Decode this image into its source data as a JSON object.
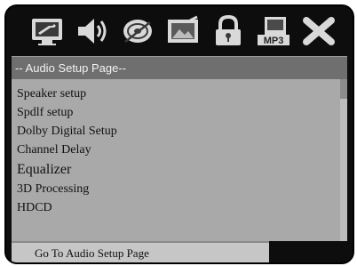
{
  "toolbar": {
    "icons": [
      {
        "name": "general-setup-icon"
      },
      {
        "name": "audio-setup-icon"
      },
      {
        "name": "dolby-setup-icon"
      },
      {
        "name": "video-setup-icon"
      },
      {
        "name": "preference-lock-icon"
      },
      {
        "name": "mp3-setup-icon",
        "label": "MP3"
      },
      {
        "name": "exit-icon"
      }
    ]
  },
  "header": {
    "title": "-- Audio Setup Page--"
  },
  "menu": {
    "items": [
      {
        "label": "Speaker setup"
      },
      {
        "label": "Spdlf setup"
      },
      {
        "label": "Dolby Digital Setup"
      },
      {
        "label": "Channel Delay"
      },
      {
        "label": "Equalizer"
      },
      {
        "label": "3D Processing"
      },
      {
        "label": "HDCD"
      }
    ]
  },
  "status": {
    "text": "Go To Audio Setup Page"
  },
  "colors": {
    "frame": "#0d0d0d",
    "header": "#6f6f6f",
    "panel": "#a9a9a9",
    "status": "#c6c6c6",
    "icon": "#d9d9d9"
  }
}
